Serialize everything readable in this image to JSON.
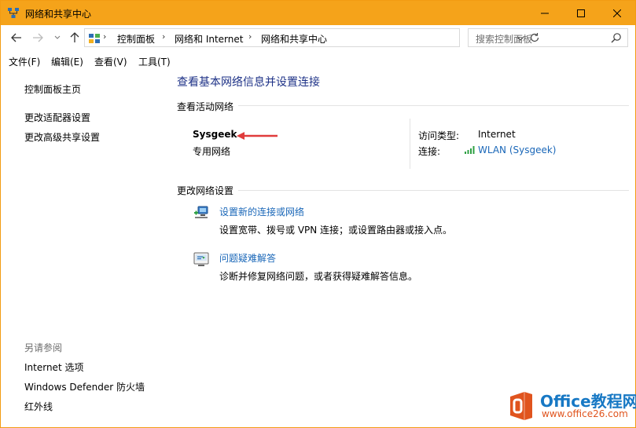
{
  "window": {
    "title": "网络和共享中心",
    "accent_color": "#f5a31a"
  },
  "titlebar_buttons": {
    "minimize_icon": "minimize-icon",
    "maximize_icon": "maximize-icon",
    "close_icon": "close-icon"
  },
  "address": {
    "breadcrumbs": [
      "控制面板",
      "网络和 Internet",
      "网络和共享中心"
    ],
    "search_placeholder": "搜索控制面板"
  },
  "menu": {
    "items": [
      "文件(F)",
      "编辑(E)",
      "查看(V)",
      "工具(T)"
    ]
  },
  "sidebar": {
    "links": [
      "控制面板主页",
      "更改适配器设置",
      "更改高级共享设置"
    ],
    "see_also_heading": "另请参阅",
    "see_also_links": [
      "Internet 选项",
      "Windows Defender 防火墙",
      "红外线"
    ]
  },
  "main": {
    "title": "查看基本网络信息并设置连接",
    "active_networks_heading": "查看活动网络",
    "network": {
      "name": "Sysgeek",
      "type": "专用网络",
      "access_type_label": "访问类型:",
      "access_type_value": "Internet",
      "connection_label": "连接:",
      "connection_value": "WLAN (Sysgeek)"
    },
    "change_settings_heading": "更改网络设置",
    "actions": [
      {
        "link": "设置新的连接或网络",
        "description": "设置宽带、拨号或 VPN 连接；或设置路由器或接入点。",
        "icon": "new-connection-icon"
      },
      {
        "link": "问题疑难解答",
        "description": "诊断并修复网络问题，或者获得疑难解答信息。",
        "icon": "troubleshoot-icon"
      }
    ]
  },
  "watermark": {
    "title": "Office教程网",
    "url": "www.office26.com"
  }
}
